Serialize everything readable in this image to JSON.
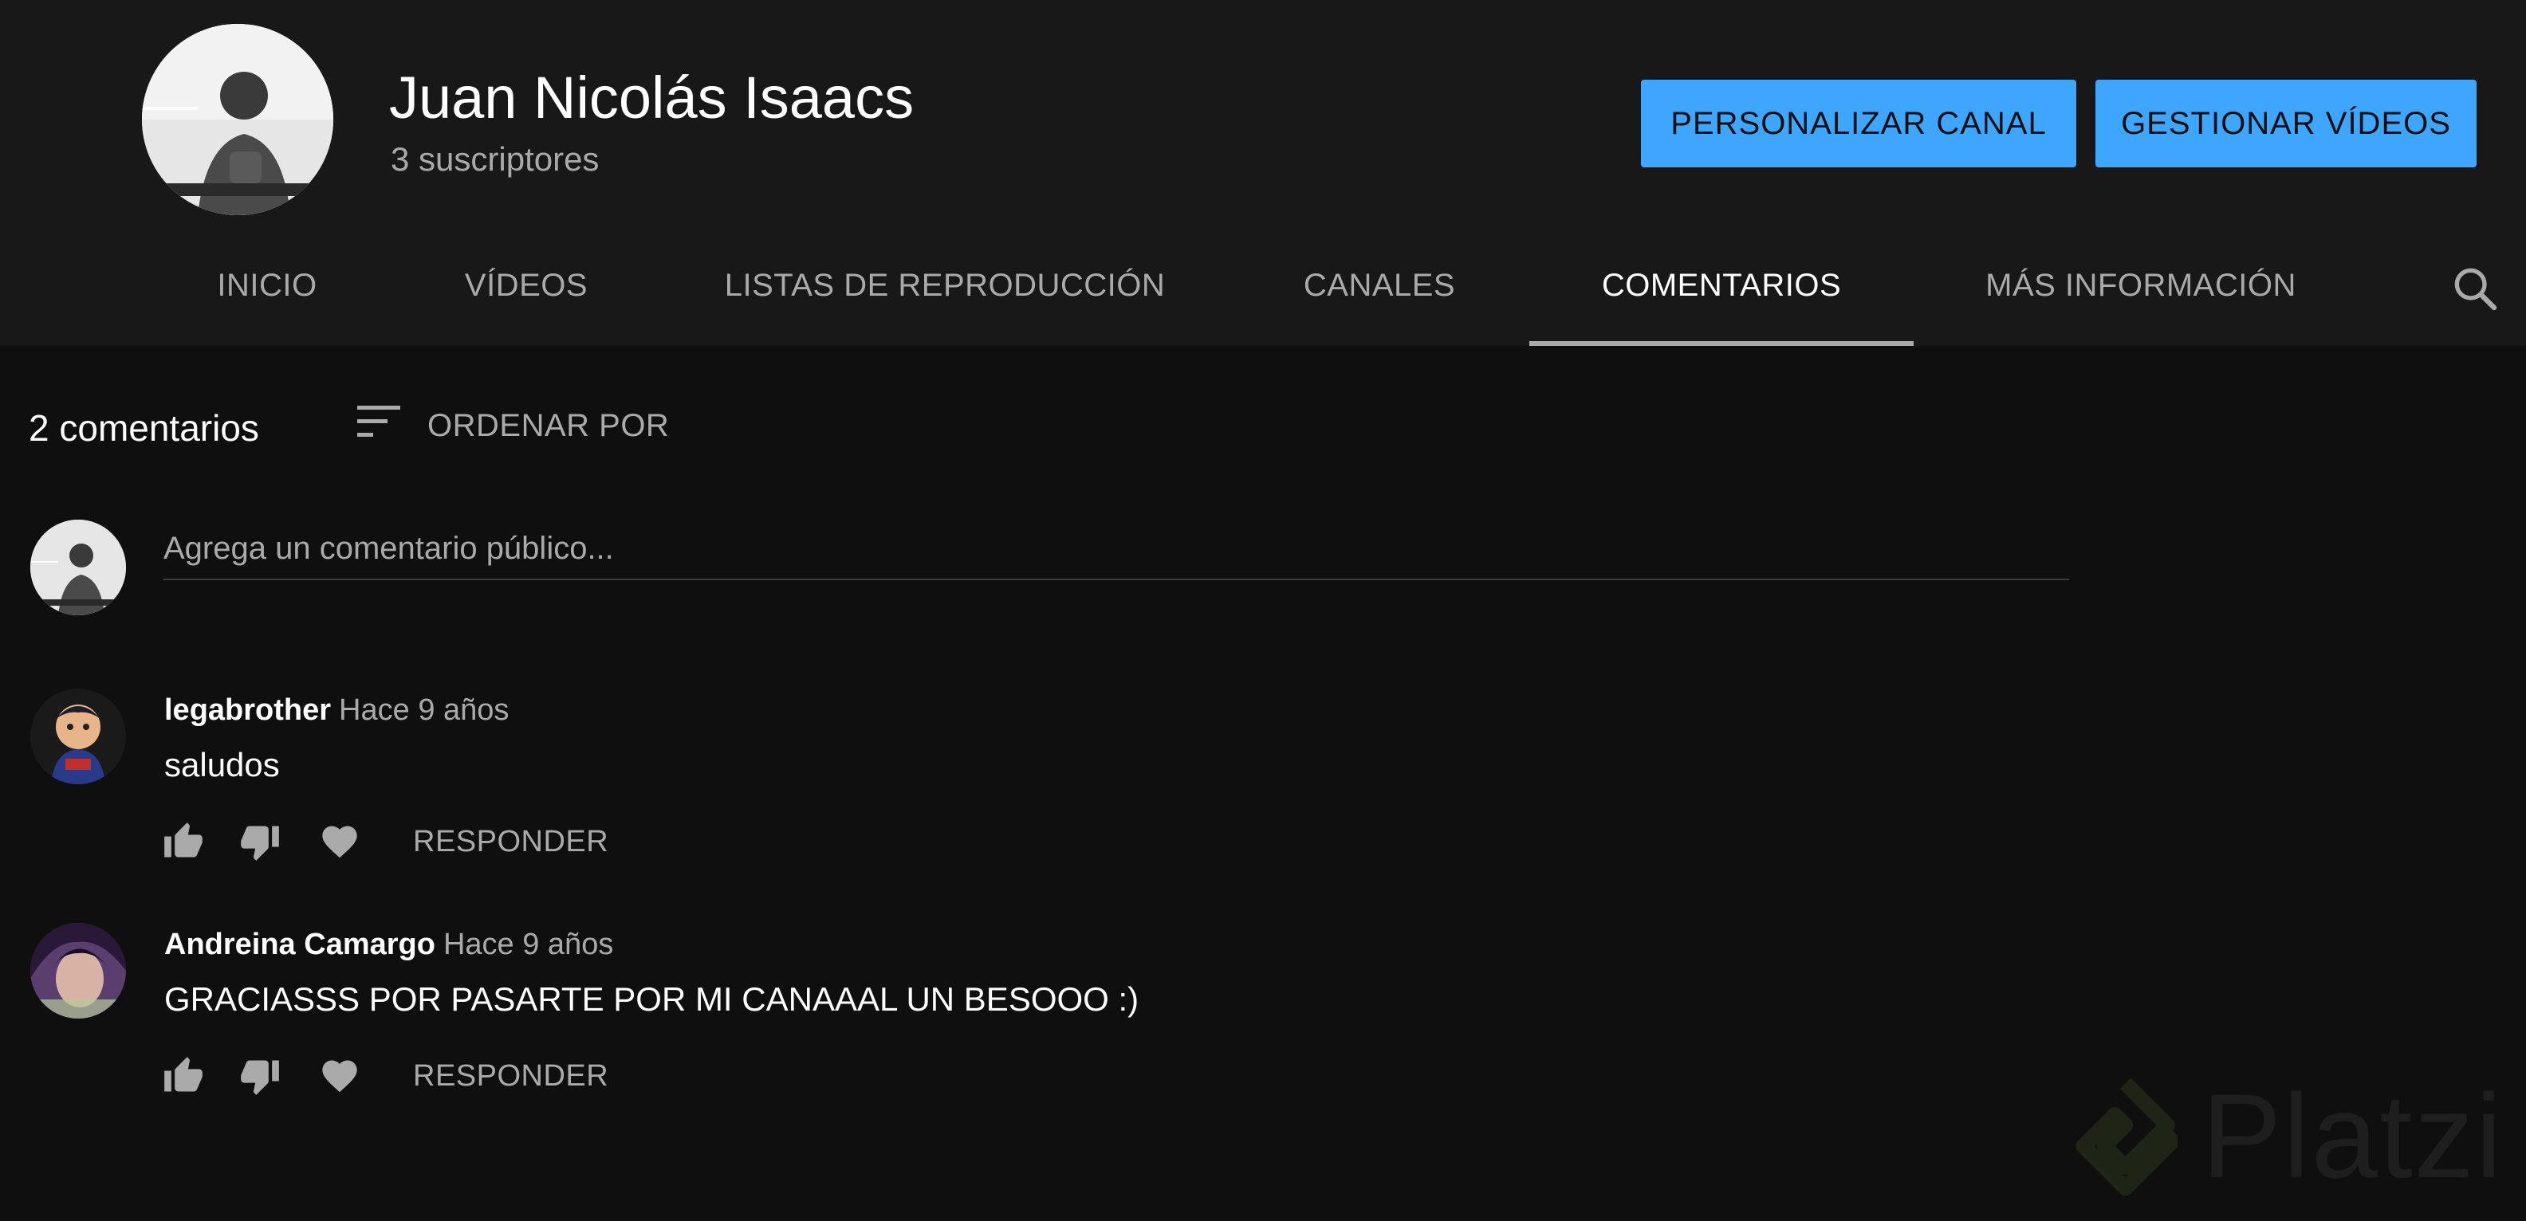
{
  "channel": {
    "name": "Juan Nicolás Isaacs",
    "subscribers": "3 suscriptores",
    "customize_label": "PERSONALIZAR CANAL",
    "manage_label": "GESTIONAR VÍDEOS"
  },
  "tabs": [
    {
      "label": "INICIO",
      "active": false
    },
    {
      "label": "VÍDEOS",
      "active": false
    },
    {
      "label": "LISTAS DE REPRODUCCIÓN",
      "active": false
    },
    {
      "label": "CANALES",
      "active": false
    },
    {
      "label": "COMENTARIOS",
      "active": true
    },
    {
      "label": "MÁS INFORMACIÓN",
      "active": false
    }
  ],
  "comments_header": {
    "count": "2 comentarios",
    "sort_label": "ORDENAR POR"
  },
  "add_comment": {
    "placeholder": "Agrega un comentario público..."
  },
  "comments": [
    {
      "author": "legabrother",
      "time": "Hace 9 años",
      "text": "saludos",
      "reply_label": "RESPONDER"
    },
    {
      "author": "Andreina Camargo",
      "time": "Hace 9 años",
      "text": "GRACIASSS POR PASARTE POR MI CANAAAL UN BESOOO :)",
      "reply_label": "RESPONDER"
    }
  ],
  "watermark": {
    "text": "Platzi"
  },
  "colors": {
    "accent": "#3ea6ff",
    "header_bg": "#181818",
    "page_bg": "#0f0f0f",
    "secondary_text": "#aaaaaa"
  },
  "icons": [
    "search-icon",
    "sort-icon",
    "thumb-up-icon",
    "thumb-down-icon",
    "heart-icon"
  ]
}
